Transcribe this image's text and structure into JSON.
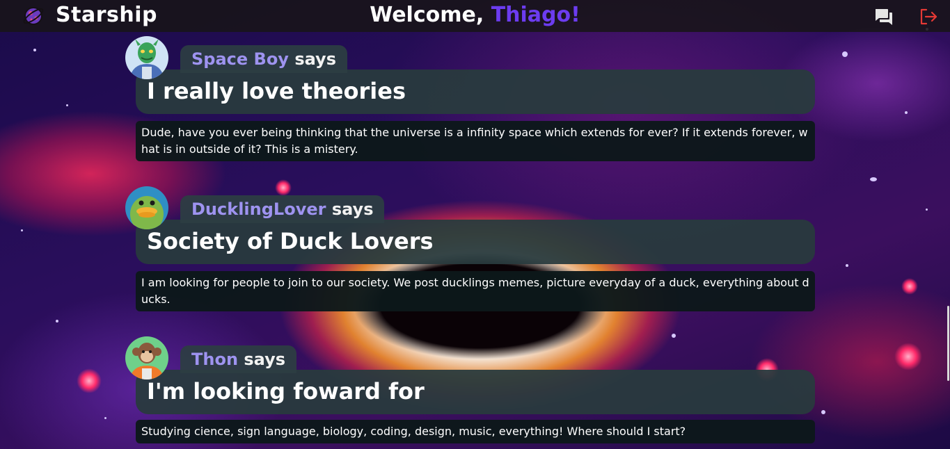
{
  "header": {
    "brand": "Starship",
    "welcome_prefix": "Welcome, ",
    "user_name": "Thiago!",
    "icons": {
      "logo": "planet-logo-icon",
      "chat": "chat-bubbles-icon",
      "logout": "logout-icon"
    },
    "colors": {
      "accent": "#6c3cf0",
      "logout": "#e53935"
    }
  },
  "posts": [
    {
      "author": "Space Boy",
      "says": "says",
      "title": "I really love theories",
      "body": "Dude, have you ever being thinking that the universe is a infinity space which extends for ever? If it extends forever, what is in outside of it? This is a mistery.",
      "avatar": "alien-astronaut-avatar"
    },
    {
      "author": "DucklingLover",
      "says": "says",
      "title": "Society of Duck Lovers",
      "body": "I am looking for people to join to our society. We post ducklings memes, picture everyday of a duck, everything about ducks.",
      "avatar": "duck-avatar"
    },
    {
      "author": "Thon",
      "says": "says",
      "title": "I'm looking foward for",
      "body": "Studying cience, sign language, biology, coding, design, music, everything! Where should I start?",
      "avatar": "monkey-astronaut-avatar"
    }
  ]
}
